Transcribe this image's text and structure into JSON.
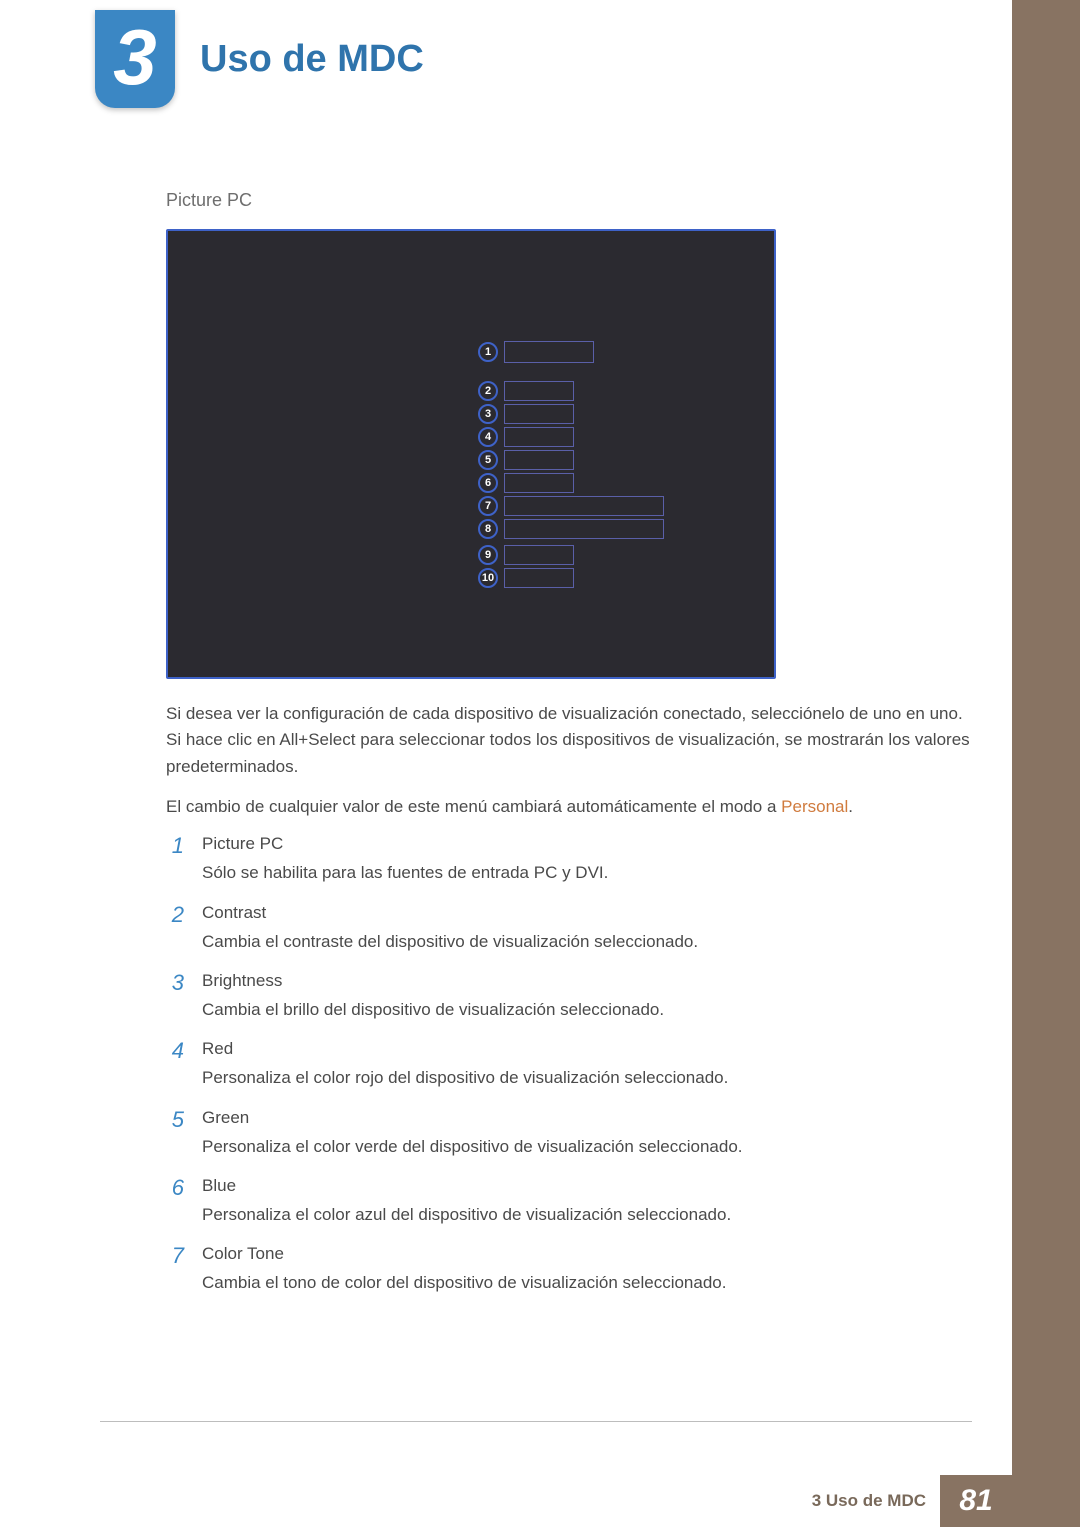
{
  "chapter": {
    "number": "3",
    "title": "Uso de MDC"
  },
  "section": {
    "label": "Picture PC"
  },
  "callouts": [
    "1",
    "2",
    "3",
    "4",
    "5",
    "6",
    "7",
    "8",
    "9",
    "10"
  ],
  "paragraphs": {
    "p1": "Si desea ver la configuración de cada dispositivo de visualización conectado, selecciónelo de uno en uno. Si hace clic en All+Select para seleccionar todos los dispositivos de visualización, se mostrarán los valores predeterminados.",
    "p2_pre": "El cambio de cualquier valor de este menú cambiará automáticamente el modo a ",
    "p2_accent": "Personal",
    "p2_post": "."
  },
  "items": [
    {
      "idx": "1",
      "title": "Picture PC",
      "desc": "Sólo se habilita para las fuentes de entrada PC y DVI."
    },
    {
      "idx": "2",
      "title": "Contrast",
      "desc": "Cambia el contraste del dispositivo de visualización seleccionado."
    },
    {
      "idx": "3",
      "title": "Brightness",
      "desc": "Cambia el brillo del dispositivo de visualización seleccionado."
    },
    {
      "idx": "4",
      "title": "Red",
      "desc": "Personaliza el color rojo del dispositivo de visualización seleccionado."
    },
    {
      "idx": "5",
      "title": "Green",
      "desc": "Personaliza el color verde del dispositivo de visualización seleccionado."
    },
    {
      "idx": "6",
      "title": "Blue",
      "desc": "Personaliza el color azul del dispositivo de visualización seleccionado."
    },
    {
      "idx": "7",
      "title": "Color Tone",
      "desc": "Cambia el tono de color del dispositivo de visualización seleccionado."
    }
  ],
  "footer": {
    "text": "3 Uso de MDC",
    "page": "81"
  }
}
